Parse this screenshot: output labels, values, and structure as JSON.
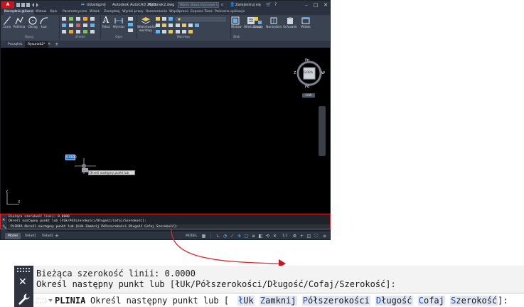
{
  "titlebar": {
    "logo": "A CAD",
    "share": "Udostępnij",
    "app_title": "Autodesk AutoCAD 2023",
    "filename": "Rysunek2.dwg",
    "search_placeholder": "Wpisz słowo kluczowe lub frazę",
    "signin": "Zarejestruj się"
  },
  "menu": [
    "Narzędzia główne",
    "Wstaw",
    "Opis",
    "Parametryczne",
    "Widok",
    "Zarządzaj",
    "Wyniki pracy",
    "Rozszerzenia",
    "Współpraca",
    "Express Tools",
    "Polecane aplikacje"
  ],
  "ribbon": {
    "tools": [
      "Linia",
      "Polilinia",
      "Okrąg",
      "Łuk",
      "Tekst",
      "Wymiar",
      "Właściwości warstwy",
      "Wstaw",
      "Właściwości",
      "Grupy",
      "Narzędzia",
      "Schowek",
      "Widok"
    ],
    "panels": [
      "Rysuj",
      "Zmień",
      "Opis",
      "Warstwy",
      "Blok"
    ]
  },
  "file_tabs": [
    "Początek",
    "Rysunek2*"
  ],
  "viewcube": {
    "north": "Pn",
    "south": "Pd",
    "west": "Z",
    "east": "W",
    "face": "GÓRA",
    "wcs": "LUW"
  },
  "drawing": {
    "dyn_value": "0.0000",
    "prompt": "Określ następny punkt lub"
  },
  "command": {
    "history_1": "Bieżąca szerokość linii: 0.0000",
    "history_2": "Określ następny punkt lub [łUk/Półszerokości/Długość/Cofaj/Szerokość]:",
    "cmd_name": "PLINIA",
    "cmd_prompt": "Określ następny punkt lub [",
    "options": [
      {
        "hot": "ł",
        "rest": "Uk"
      },
      {
        "hot": "Z",
        "rest": "amknij"
      },
      {
        "hot": "P",
        "rest": "ółszerokości"
      },
      {
        "hot": "D",
        "rest": "ługość"
      },
      {
        "hot": "C",
        "rest": "ofaj"
      },
      {
        "hot": "S",
        "rest": "zerokość"
      }
    ],
    "cmd_end": "]:",
    "small_line": "Określ następny punkt lub [ŁUk Zamknij Półszerokości Długość Cofaj Szerokość]:"
  },
  "status": {
    "tabs": [
      "Model",
      "Układ1",
      "Układ2"
    ],
    "model_label": "MODEL",
    "scale": "1:1"
  },
  "colors": {
    "callout": "#e0252b",
    "accent": "#4fa3e0",
    "viewport": "#000000"
  }
}
